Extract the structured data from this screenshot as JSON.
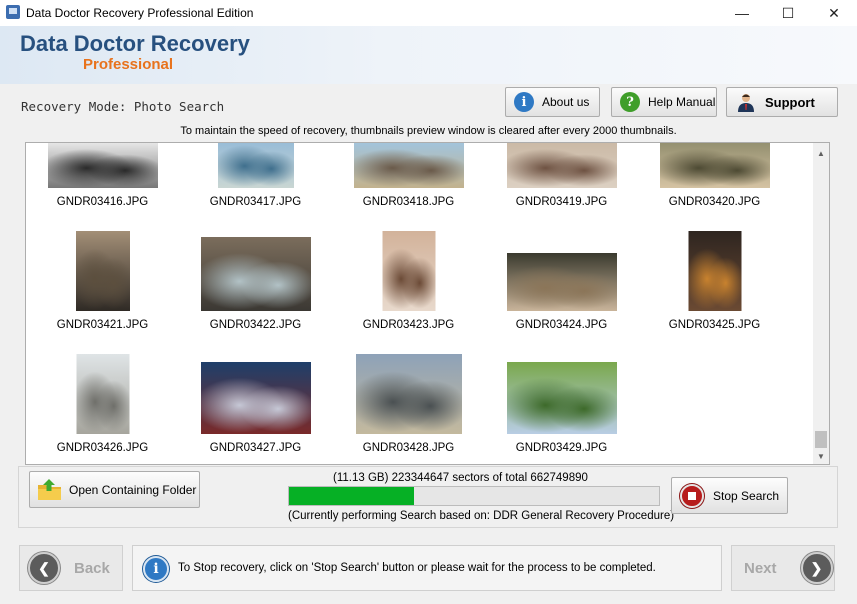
{
  "window": {
    "title": "Data Doctor Recovery Professional Edition",
    "minimize": "—",
    "maximize": "☐",
    "close": "✕"
  },
  "header": {
    "brand_main": "Data Doctor Recovery",
    "brand_sub": "Professional"
  },
  "mode_label": "Recovery Mode: Photo Search",
  "buttons": {
    "about": "About us",
    "help": "Help Manual",
    "support": "Support"
  },
  "notice": "To maintain the speed of recovery, thumbnails preview window is cleared after every 2000 thumbnails.",
  "thumbnails": [
    {
      "name": "GNDR03416.JPG",
      "colors": [
        "#f2f2f2",
        "#2a2a2a",
        "#777777"
      ]
    },
    {
      "name": "GNDR03417.JPG",
      "colors": [
        "#8fb7d8",
        "#3f6f8d",
        "#c9d6d3"
      ]
    },
    {
      "name": "GNDR03418.JPG",
      "colors": [
        "#9fc6e4",
        "#6a5a4a",
        "#c2b28d"
      ]
    },
    {
      "name": "GNDR03419.JPG",
      "colors": [
        "#c9b7a3",
        "#6e5242",
        "#dcd0c2"
      ]
    },
    {
      "name": "GNDR03420.JPG",
      "colors": [
        "#8d8a6a",
        "#4d4a33",
        "#d5c3a3"
      ]
    },
    {
      "name": "GNDR03421.JPG",
      "colors": [
        "#a38f77",
        "#5c4f3e",
        "#2f2a25"
      ]
    },
    {
      "name": "GNDR03422.JPG",
      "colors": [
        "#7b6d5c",
        "#b2c2c6",
        "#3b3833"
      ]
    },
    {
      "name": "GNDR03423.JPG",
      "colors": [
        "#d2b29a",
        "#6b4a36",
        "#e8d9cc"
      ]
    },
    {
      "name": "GNDR03424.JPG",
      "colors": [
        "#3a3a2e",
        "#8b7558",
        "#c9b49a"
      ]
    },
    {
      "name": "GNDR03425.JPG",
      "colors": [
        "#2e2520",
        "#c8822e",
        "#6b4a33"
      ]
    },
    {
      "name": "GNDR03426.JPG",
      "colors": [
        "#dfe4e6",
        "#6f6f6a",
        "#a6a59d"
      ]
    },
    {
      "name": "GNDR03427.JPG",
      "colors": [
        "#1e3f6a",
        "#c6c8d6",
        "#7a2a2a"
      ]
    },
    {
      "name": "GNDR03428.JPG",
      "colors": [
        "#8ea2b8",
        "#4a5052",
        "#c3b99e"
      ]
    },
    {
      "name": "GNDR03429.JPG",
      "colors": [
        "#7aa84d",
        "#3d6a2a",
        "#b8cde4"
      ]
    }
  ],
  "open_folder": "Open Containing Folder",
  "sectors_text": "(11.13 GB) 223344647  sectors  of  total 662749890",
  "progress": {
    "done": 223344647,
    "total": 662749890,
    "fill_color": "#06b025"
  },
  "procedure_text": "(Currently performing Search based on:  DDR General Recovery Procedure)",
  "stop_search": "Stop Search",
  "back": "Back",
  "next": "Next",
  "status_message": "To Stop recovery, click on 'Stop Search' button or please wait for the process to be completed."
}
